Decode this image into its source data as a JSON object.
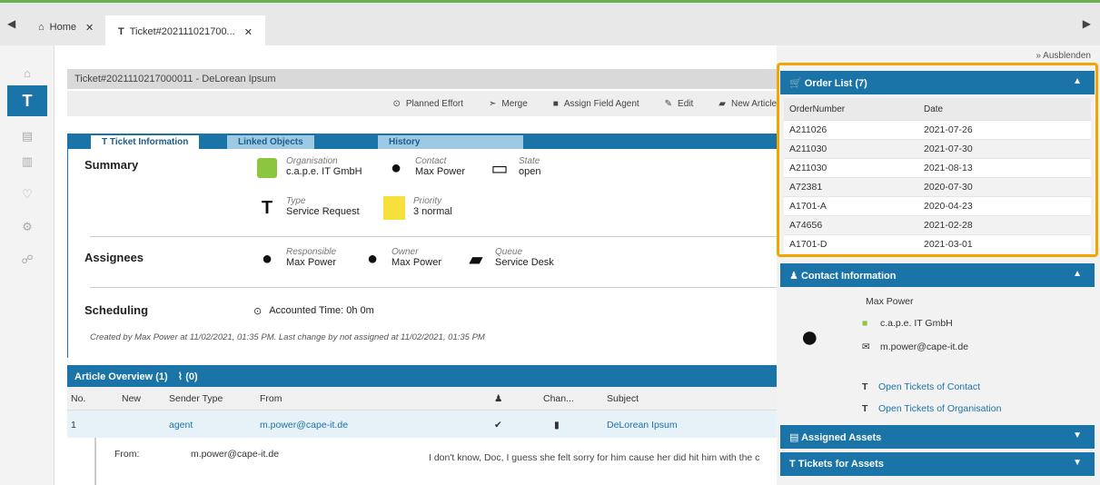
{
  "tabs": {
    "home_label": "Home",
    "ticket_label": "Ticket#202111021700..."
  },
  "sidebar": {
    "items": [
      {
        "icon": "home-icon"
      },
      {
        "icon": "ticket-icon",
        "label": "T"
      },
      {
        "icon": "database-icon"
      },
      {
        "icon": "chart-icon"
      },
      {
        "icon": "lightbulb-icon"
      },
      {
        "icon": "gear-icon"
      },
      {
        "icon": "hierarchy-icon"
      }
    ]
  },
  "ticket": {
    "title": "Ticket#2021110217000011 - DeLorean Ipsum",
    "actions": [
      "Planned Effort",
      "Merge",
      "Assign Field Agent",
      "Edit",
      "New Article"
    ],
    "tabs": [
      "Ticket Information",
      "Linked Objects",
      "History"
    ],
    "summary_label": "Summary",
    "organisation_label": "Organisation",
    "organisation_value": "c.a.p.e. IT GmbH",
    "contact_label": "Contact",
    "contact_value": "Max Power",
    "state_label": "State",
    "state_value": "open",
    "type_label": "Type",
    "type_value": "Service Request",
    "priority_label": "Priority",
    "priority_value": "3 normal",
    "priority_color": "#f7e03c",
    "assignees_label": "Assignees",
    "responsible_label": "Responsible",
    "responsible_value": "Max Power",
    "owner_label": "Owner",
    "owner_value": "Max Power",
    "queue_label": "Queue",
    "queue_value": "Service Desk",
    "scheduling_label": "Scheduling",
    "accounted_time": "Accounted Time: 0h 0m",
    "created_line": "Created by Max Power at 11/02/2021, 01:35 PM. Last change by not assigned at 11/02/2021, 01:35 PM"
  },
  "articles": {
    "title": "Article Overview (1)",
    "attachments": "(0)",
    "columns": [
      "No.",
      "New",
      "Sender Type",
      "From",
      "Chan...",
      "Subject"
    ],
    "row": {
      "no": "1",
      "sender_type": "agent",
      "from": "m.power@cape-it.de",
      "subject": "DeLorean Ipsum"
    },
    "detail_from_label": "From:",
    "detail_from_value": "m.power@cape-it.de",
    "body_preview": "I don't know, Doc, I guess she felt sorry for him cause her did hit him with the c"
  },
  "right": {
    "hide_label": "Ausblenden",
    "order_list_title": "Order List (7)",
    "order_columns": [
      "OrderNumber",
      "Date"
    ],
    "orders": [
      [
        "A211026",
        "2021-07-26"
      ],
      [
        "A211030",
        "2021-07-30"
      ],
      [
        "A211030",
        "2021-08-13"
      ],
      [
        "A72381",
        "2020-07-30"
      ],
      [
        "A1701-A",
        "2020-04-23"
      ],
      [
        "A74656",
        "2021-02-28"
      ],
      [
        "A1701-D",
        "2021-03-01"
      ]
    ],
    "contact_title": "Contact Information",
    "contact_name": "Max Power",
    "contact_org": "c.a.p.e. IT GmbH",
    "contact_email": "m.power@cape-it.de",
    "open_tickets_contact": "Open Tickets of Contact",
    "open_tickets_org": "Open Tickets of Organisation",
    "assigned_assets": "Assigned Assets",
    "tickets_for_assets": "Tickets for Assets"
  },
  "colors": {
    "accent": "#1a74a8",
    "highlight": "#f0a500"
  }
}
